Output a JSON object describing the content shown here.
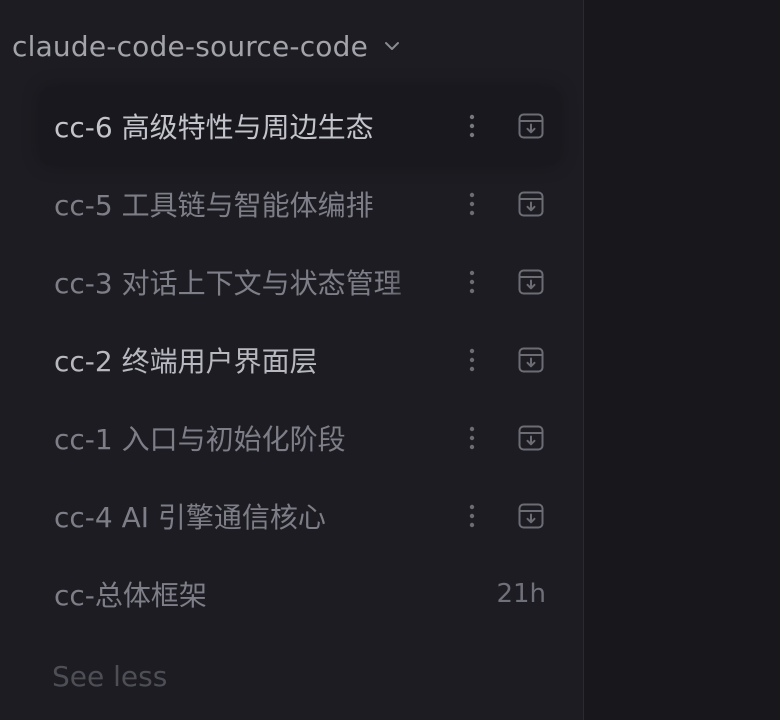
{
  "project": {
    "name": "claude-code-source-code",
    "toggle_icon": "chevron-down-icon"
  },
  "threads": [
    {
      "title": "cc-6 高级特性与周边生态",
      "state": "active"
    },
    {
      "title": "cc-5 工具链与智能体编排",
      "state": "normal"
    },
    {
      "title": "cc-3 对话上下文与状态管理",
      "state": "normal"
    },
    {
      "title": "cc-2 终端用户界面层",
      "state": "bright"
    },
    {
      "title": "cc-1 入口与初始化阶段",
      "state": "normal"
    },
    {
      "title": "cc-4 AI 引擎通信核心",
      "state": "normal"
    },
    {
      "title": "cc-总体框架",
      "state": "normal",
      "time": "21h"
    }
  ],
  "footer": {
    "see_less_label": "See less"
  },
  "colors": {
    "sidebar_bg": "#1c1c22",
    "main_bg": "#17171c",
    "text_dim": "#7e7e88",
    "text_bright": "#c4c4cc",
    "icon": "#6c6c75"
  }
}
